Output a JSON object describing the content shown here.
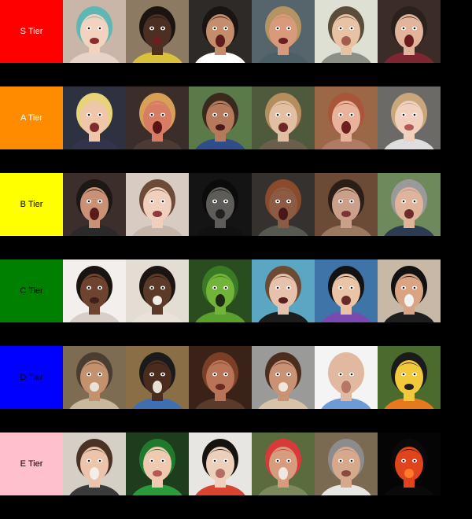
{
  "tiers": [
    {
      "label": "S Tier",
      "color": "#ff0000",
      "text_color": "#ffffff",
      "items": [
        {
          "name": "shocked-woman-teal-hair-tile",
          "bg": "#c9b6a8",
          "skin": "#f2d3bf",
          "hair": "#5fb7b3",
          "mouth": "#8b2c2c",
          "shirt": "#e7d3c7"
        },
        {
          "name": "shocked-boy-yellow-shirt-tile",
          "bg": "#8d7a62",
          "skin": "#4b2f22",
          "hair": "#1b1410",
          "mouth": "#6a2020",
          "shirt": "#d9c23a"
        },
        {
          "name": "screaming-girl-dark-hair-tile",
          "bg": "#2e2a28",
          "skin": "#c68d6c",
          "hair": "#1a1512",
          "mouth": "#5d1d1d",
          "shirt": "#ffffff"
        },
        {
          "name": "yelling-man-blonde-tile",
          "bg": "#56646b",
          "skin": "#d99a7b",
          "hair": "#b49462",
          "mouth": "#6c1f1f",
          "shirt": "#4a5f66"
        },
        {
          "name": "grimacing-man-grey-shirt-tile",
          "bg": "#dfe0d4",
          "skin": "#e8c2a4",
          "hair": "#5a4d3b",
          "mouth": "#a35b4d",
          "shirt": "#8c8f84"
        },
        {
          "name": "gamer-headset-shocked-tile",
          "bg": "#3c2c27",
          "skin": "#e2b49b",
          "hair": "#2b211c",
          "mouth": "#6b1d1d",
          "shirt": "#7d2631"
        }
      ]
    },
    {
      "label": "A Tier",
      "color": "#ff8c00",
      "text_color": "#ffffff",
      "items": [
        {
          "name": "yelling-man-glasses-tile",
          "bg": "#2e3140",
          "skin": "#efc6aa",
          "hair": "#e8d27a",
          "mouth": "#7d2b2b",
          "shirt": "#31344a"
        },
        {
          "name": "screaming-red-face-man-tile",
          "bg": "#3b2d2a",
          "skin": "#d77d63",
          "hair": "#d8a056",
          "mouth": "#5b1414",
          "shirt": "#4c3a33"
        },
        {
          "name": "shocked-woman-forest-tile",
          "bg": "#5a7a49",
          "skin": "#b57a5b",
          "hair": "#3a2a1e",
          "mouth": "#4a1a1a",
          "shirt": "#2e4d8a"
        },
        {
          "name": "screaming-curly-hair-woman-tile",
          "bg": "#4e5a3b",
          "skin": "#e2bfa2",
          "hair": "#b58d5e",
          "mouth": "#6d2727",
          "shirt": "#6b5e4d"
        },
        {
          "name": "screaming-woman-brown-hair-tile",
          "bg": "#9c6746",
          "skin": "#e8b39a",
          "hair": "#a8553a",
          "mouth": "#6d1f1f",
          "shirt": "#b07a64"
        },
        {
          "name": "surprised-baby-tile",
          "bg": "#6b6a66",
          "skin": "#f1d0bd",
          "hair": "#c8a77c",
          "mouth": "#b35a58",
          "shirt": "#dedede"
        }
      ]
    },
    {
      "label": "B Tier",
      "color": "#ffff00",
      "text_color": "#000000",
      "items": [
        {
          "name": "hypno-glasses-man-tile",
          "bg": "#3b2e2b",
          "skin": "#c99276",
          "hair": "#1d1816",
          "mouth": "#5a1b1b",
          "shirt": "#2a2a2a"
        },
        {
          "name": "surprised-woman-bangs-tile",
          "bg": "#d8ccc2",
          "skin": "#f0cfbd",
          "hair": "#6e4b39",
          "mouth": "#8b3b3b",
          "shirt": "#c6b6aa"
        },
        {
          "name": "dark-ghost-face-tile",
          "bg": "#141414",
          "skin": "#5e5c58",
          "hair": "#0b0b0b",
          "mouth": "#222222",
          "shirt": "#111111"
        },
        {
          "name": "man-beanie-shocked-tile",
          "bg": "#35312f",
          "skin": "#8c5b44",
          "hair": "#8a4b2d",
          "mouth": "#4a1818",
          "shirt": "#56594f"
        },
        {
          "name": "crying-baby-tile",
          "bg": "#6b4a36",
          "skin": "#caa08a",
          "hair": "#2b1e16",
          "mouth": "#7a3434",
          "shirt": "#9a7a5e"
        },
        {
          "name": "surprised-grey-hair-man-tile",
          "bg": "#6e8a5c",
          "skin": "#e0b39b",
          "hair": "#9a9a9a",
          "mouth": "#6f2a2a",
          "shirt": "#2c3a52"
        }
      ]
    },
    {
      "label": "C Tier",
      "color": "#008000",
      "text_color": "#000000",
      "items": [
        {
          "name": "braids-woman-tile",
          "bg": "#f2efec",
          "skin": "#6e4330",
          "hair": "#1a1410",
          "mouth": "#3e1f1a",
          "shirt": "#d8d0c8"
        },
        {
          "name": "young-man-earbuds-tile",
          "bg": "#e3ddd4",
          "skin": "#5b3a2a",
          "hair": "#1b1411",
          "mouth": "#f0ece6",
          "shirt": "#e9e2d8"
        },
        {
          "name": "green-peppers-faces-tile",
          "bg": "#294d1e",
          "skin": "#72b43a",
          "hair": "#3a7a24",
          "mouth": "#1e2a14",
          "shirt": "#5aa02c"
        },
        {
          "name": "laughing-girl-wheelchair-tile",
          "bg": "#5aa6c3",
          "skin": "#e6c2ad",
          "hair": "#6d4a34",
          "mouth": "#5a1f1f",
          "shirt": "#1d1d1d"
        },
        {
          "name": "man-glasses-purple-shirt-tile",
          "bg": "#3f74a8",
          "skin": "#e9c4a6",
          "hair": "#121212",
          "mouth": "#6a2a2a",
          "shirt": "#7a4ab0"
        },
        {
          "name": "man-black-cap-grimace-tile",
          "bg": "#c7b9a6",
          "skin": "#d8a484",
          "hair": "#111111",
          "mouth": "#f2f2f2",
          "shirt": "#1e1e1e"
        }
      ]
    },
    {
      "label": "D Tier",
      "color": "#0000ff",
      "text_color": "#000000",
      "items": [
        {
          "name": "laughing-old-man-tile",
          "bg": "#7d6b52",
          "skin": "#c4916f",
          "hair": "#4a3e30",
          "mouth": "#eae2d4",
          "shirt": "#c9b89b"
        },
        {
          "name": "man-cap-squinting-tile",
          "bg": "#8a6f46",
          "skin": "#4a2c1f",
          "hair": "#1a1a1a",
          "mouth": "#e8e0d4",
          "shirt": "#3f6fb0"
        },
        {
          "name": "woman-curly-hair-disgust-tile",
          "bg": "#3a2218",
          "skin": "#b97457",
          "hair": "#7a3f24",
          "mouth": "#6a2a20",
          "shirt": "#5a3a2a"
        },
        {
          "name": "woman-headband-laughing-tile",
          "bg": "#9a9a98",
          "skin": "#c99274",
          "hair": "#4b2e1e",
          "mouth": "#f0e6dc",
          "shirt": "#d8c2a8"
        },
        {
          "name": "bald-man-blue-shirt-tile",
          "bg": "#f4f4f4",
          "skin": "#e0b9a0",
          "hair": "#e0b9a0",
          "mouth": "#b77765",
          "shirt": "#6c9bd6"
        },
        {
          "name": "lego-figure-flower-tile",
          "bg": "#4a6a2e",
          "skin": "#f2c93a",
          "hair": "#1b1b1b",
          "mouth": "#222222",
          "shirt": "#e6781e"
        }
      ]
    },
    {
      "label": "E Tier",
      "color": "#ffc0cb",
      "text_color": "#000000",
      "items": [
        {
          "name": "smiling-boy-vest-tile",
          "bg": "#d6cfc6",
          "skin": "#ebc4ab",
          "hair": "#4a3324",
          "mouth": "#f4eee8",
          "shirt": "#3b3b3b"
        },
        {
          "name": "baby-elf-costume-tile",
          "bg": "#1e3d1c",
          "skin": "#efc9b0",
          "hair": "#1f7a2e",
          "mouth": "#b55858",
          "shirt": "#2a9a3a"
        },
        {
          "name": "girl-black-bob-tile",
          "bg": "#e8e6e2",
          "skin": "#edd0bb",
          "hair": "#161210",
          "mouth": "#b46d63",
          "shirt": "#d8442f"
        },
        {
          "name": "boy-red-cap-smiling-tile",
          "bg": "#5a6b3e",
          "skin": "#d69c7d",
          "hair": "#d83a3a",
          "mouth": "#f0e8e0",
          "shirt": "#7a8a5a"
        },
        {
          "name": "seated-man-office-tile",
          "bg": "#7a6a52",
          "skin": "#d6a98d",
          "hair": "#8c8c8c",
          "mouth": "#8a4a3c",
          "shirt": "#e8e6e2"
        },
        {
          "name": "glowing-pumpkin-dark-tile",
          "bg": "#050505",
          "skin": "#e0441c",
          "hair": "#0a0a0a",
          "mouth": "#ff7a2a",
          "shirt": "#0a0a0a"
        }
      ]
    }
  ]
}
